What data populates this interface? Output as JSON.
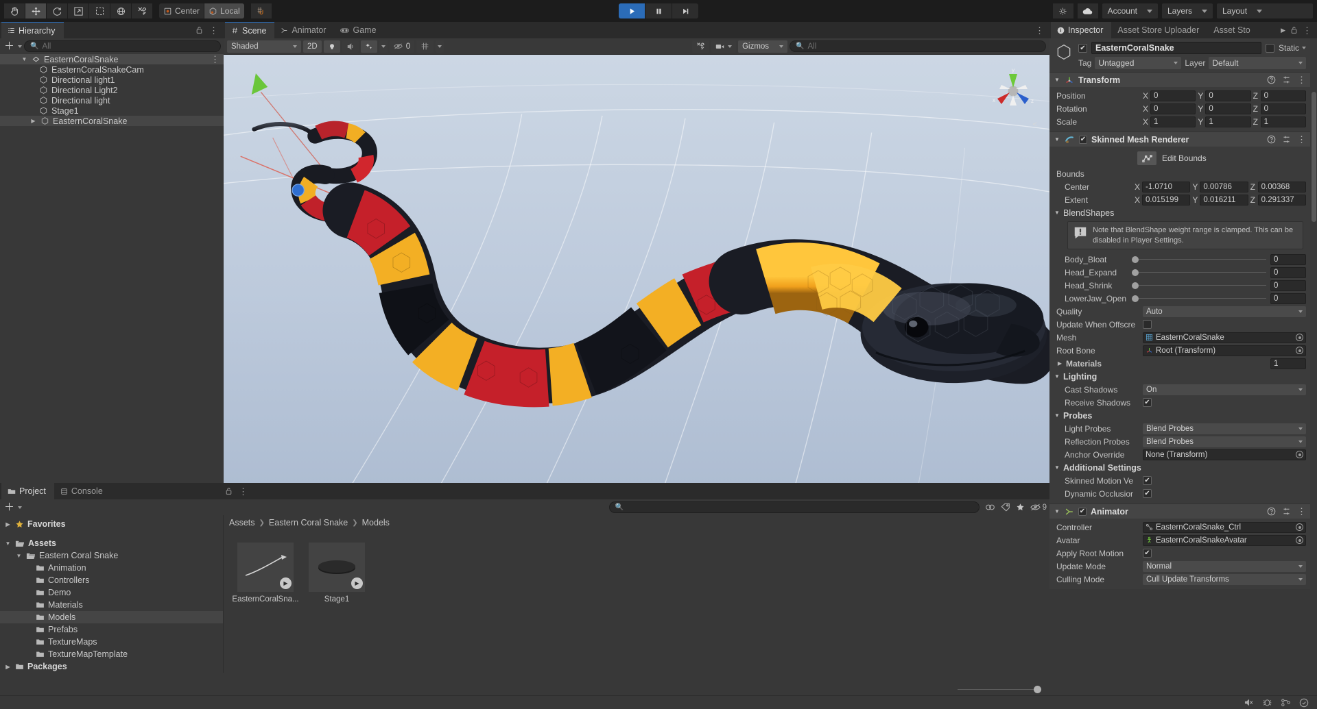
{
  "toolbar": {
    "tools": [
      {
        "name": "hand-tool",
        "label": ""
      },
      {
        "name": "move-tool",
        "label": ""
      },
      {
        "name": "rotate-tool",
        "label": ""
      },
      {
        "name": "scale-tool",
        "label": ""
      },
      {
        "name": "rect-tool",
        "label": ""
      },
      {
        "name": "transform-tool",
        "label": ""
      },
      {
        "name": "custom-tool",
        "label": ""
      }
    ],
    "pivot_label": "Center",
    "space_label": "Local",
    "play_tooltip": "Play",
    "pause_tooltip": "Pause",
    "step_tooltip": "Step",
    "account_label": "Account",
    "layers_label": "Layers",
    "layout_label": "Layout"
  },
  "hierarchy": {
    "tab_label": "Hierarchy",
    "search_placeholder": "All",
    "items": [
      {
        "label": "EasternCoralSnake",
        "depth": 0,
        "expanded": true,
        "selected": true,
        "kind": "scene"
      },
      {
        "label": "EasternCoralSnakeCam",
        "depth": 1,
        "expanded": null,
        "selected": false,
        "kind": "object"
      },
      {
        "label": "Directional light1",
        "depth": 1,
        "expanded": null,
        "selected": false,
        "kind": "object"
      },
      {
        "label": "Directional Light2",
        "depth": 1,
        "expanded": null,
        "selected": false,
        "kind": "object"
      },
      {
        "label": "Directional light",
        "depth": 1,
        "expanded": null,
        "selected": false,
        "kind": "object"
      },
      {
        "label": "Stage1",
        "depth": 1,
        "expanded": null,
        "selected": false,
        "kind": "object"
      },
      {
        "label": "EasternCoralSnake",
        "depth": 1,
        "expanded": false,
        "selected": true,
        "kind": "object"
      }
    ]
  },
  "scene": {
    "tabs": [
      {
        "label": "Scene",
        "active": true,
        "icon": "hash-icon"
      },
      {
        "label": "Animator",
        "active": false,
        "icon": "animator-icon"
      },
      {
        "label": "Game",
        "active": false,
        "icon": "gamepad-icon"
      }
    ],
    "draw_mode": "Shaded",
    "two_d_label": "2D",
    "effects_count": "0",
    "gizmos_label": "Gizmos",
    "search_placeholder": "All",
    "gizmo_axes": {
      "x": "x",
      "y": "y",
      "z": "z"
    }
  },
  "project": {
    "tabs": [
      {
        "label": "Project",
        "active": true,
        "icon": "folder-icon"
      },
      {
        "label": "Console",
        "active": false,
        "icon": "console-icon"
      }
    ],
    "search_placeholder": "",
    "visible_count": "9",
    "tree": [
      {
        "label": "Favorites",
        "depth": 0,
        "arrow": "right",
        "icon": "star-icon",
        "bold": true,
        "selected": false
      },
      {
        "label": "Assets",
        "depth": 0,
        "arrow": "down",
        "icon": "folder-open-icon",
        "bold": true,
        "selected": false
      },
      {
        "label": "Eastern Coral Snake",
        "depth": 1,
        "arrow": "down",
        "icon": "folder-open-icon",
        "bold": false,
        "selected": false
      },
      {
        "label": "Animation",
        "depth": 2,
        "arrow": "none",
        "icon": "folder-icon",
        "bold": false,
        "selected": false
      },
      {
        "label": "Controllers",
        "depth": 2,
        "arrow": "none",
        "icon": "folder-icon",
        "bold": false,
        "selected": false
      },
      {
        "label": "Demo",
        "depth": 2,
        "arrow": "none",
        "icon": "folder-icon",
        "bold": false,
        "selected": false
      },
      {
        "label": "Materials",
        "depth": 2,
        "arrow": "none",
        "icon": "folder-icon",
        "bold": false,
        "selected": false
      },
      {
        "label": "Models",
        "depth": 2,
        "arrow": "none",
        "icon": "folder-icon",
        "bold": false,
        "selected": true
      },
      {
        "label": "Prefabs",
        "depth": 2,
        "arrow": "none",
        "icon": "folder-icon",
        "bold": false,
        "selected": false
      },
      {
        "label": "TextureMaps",
        "depth": 2,
        "arrow": "none",
        "icon": "folder-icon",
        "bold": false,
        "selected": false
      },
      {
        "label": "TextureMapTemplate",
        "depth": 2,
        "arrow": "none",
        "icon": "folder-icon",
        "bold": false,
        "selected": false
      },
      {
        "label": "Packages",
        "depth": 0,
        "arrow": "right",
        "icon": "folder-icon",
        "bold": true,
        "selected": false
      }
    ],
    "breadcrumb": [
      "Assets",
      "Eastern Coral Snake",
      "Models"
    ],
    "assets": [
      {
        "label": "EasternCoralSna...",
        "kind": "model"
      },
      {
        "label": "Stage1",
        "kind": "model"
      }
    ]
  },
  "inspector": {
    "tabs": [
      {
        "label": "Inspector",
        "active": true
      },
      {
        "label": "Asset Store Uploader",
        "active": false
      },
      {
        "label": "Asset Sto",
        "active": false
      }
    ],
    "object_name": "EasternCoralSnake",
    "enabled": true,
    "static_label": "Static",
    "static_checked": false,
    "tag_label": "Tag",
    "tag_value": "Untagged",
    "layer_label": "Layer",
    "layer_value": "Default",
    "transform": {
      "title": "Transform",
      "rows": [
        {
          "label": "Position",
          "x": "0",
          "y": "0",
          "z": "0"
        },
        {
          "label": "Rotation",
          "x": "0",
          "y": "0",
          "z": "0"
        },
        {
          "label": "Scale",
          "x": "1",
          "y": "1",
          "z": "1"
        }
      ]
    },
    "skinned_mesh_renderer": {
      "title": "Skinned Mesh Renderer",
      "enabled": true,
      "edit_bounds_label": "Edit Bounds",
      "bounds_label": "Bounds",
      "bounds": [
        {
          "label": "Center",
          "x": "-1.0710",
          "y": "0.00786",
          "z": "0.00368"
        },
        {
          "label": "Extent",
          "x": "0.015199",
          "y": "0.016211",
          "z": "0.291337"
        }
      ],
      "blendshapes_label": "BlendShapes",
      "note_text": "Note that BlendShape weight range is clamped. This can be disabled in Player Settings.",
      "blendshapes": [
        {
          "label": "Body_Bloat",
          "value": "0"
        },
        {
          "label": "Head_Expand",
          "value": "0"
        },
        {
          "label": "Head_Shrink",
          "value": "0"
        },
        {
          "label": "LowerJaw_Open",
          "value": "0"
        }
      ],
      "quality_label": "Quality",
      "quality_value": "Auto",
      "update_offscreen_label": "Update When Offscre",
      "update_offscreen_checked": false,
      "mesh_label": "Mesh",
      "mesh_value": "EasternCoralSnake",
      "root_bone_label": "Root Bone",
      "root_bone_value": "Root (Transform)",
      "materials_label": "Materials",
      "materials_count": "1",
      "lighting_label": "Lighting",
      "cast_shadows_label": "Cast Shadows",
      "cast_shadows_value": "On",
      "receive_shadows_label": "Receive Shadows",
      "receive_shadows_checked": true,
      "probes_label": "Probes",
      "light_probes_label": "Light Probes",
      "light_probes_value": "Blend Probes",
      "reflection_probes_label": "Reflection Probes",
      "reflection_probes_value": "Blend Probes",
      "anchor_override_label": "Anchor Override",
      "anchor_override_value": "None (Transform)",
      "additional_settings_label": "Additional Settings",
      "skinned_motion_label": "Skinned Motion Ve",
      "skinned_motion_checked": true,
      "dynamic_occlusion_label": "Dynamic Occlusior",
      "dynamic_occlusion_checked": true
    },
    "animator": {
      "title": "Animator",
      "enabled": true,
      "controller_label": "Controller",
      "controller_value": "EasternCoralSnake_Ctrl",
      "avatar_label": "Avatar",
      "avatar_value": "EasternCoralSnakeAvatar",
      "apply_root_motion_label": "Apply Root Motion",
      "apply_root_motion_checked": true,
      "update_mode_label": "Update Mode",
      "update_mode_value": "Normal",
      "culling_mode_label": "Culling Mode",
      "culling_mode_value": "Cull Update Transforms"
    }
  },
  "colors": {
    "accent_blue": "#2b6cb8",
    "panel_bg": "#383838",
    "toolbar_bg": "#1c1c1c",
    "snake_red": "#c1272d",
    "snake_yellow": "#f5a623",
    "snake_black": "#1a1a1f"
  }
}
